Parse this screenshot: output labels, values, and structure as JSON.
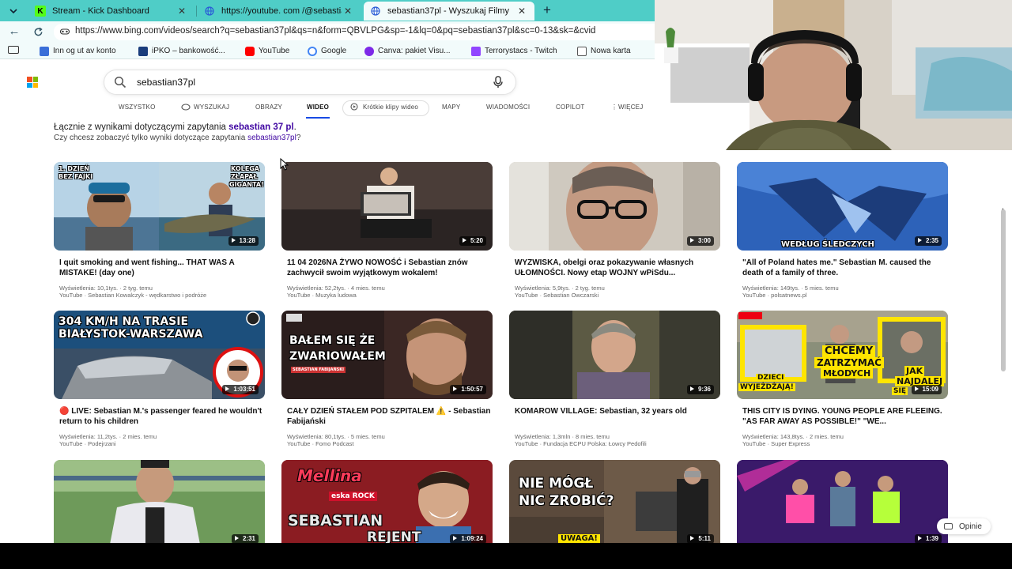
{
  "browser": {
    "tabs": [
      {
        "title": "Stream - Kick Dashboard",
        "favicon": "kick-favicon",
        "active": false
      },
      {
        "title": "https://youtube. com /@sebastian",
        "favicon": "globe-favicon",
        "active": false
      },
      {
        "title": "sebastian37pl - Wyszukaj Filmy",
        "favicon": "bing-favicon",
        "active": true
      }
    ],
    "url": "https://www.bing.com/videos/search?q=sebastian37pl&qs=n&form=QBVLPG&sp=-1&lq=0&pq=sebastian37pl&sc=0-13&sk=&cvid",
    "bookmarks": [
      {
        "label": "Inn og ut av konto",
        "icon": "puzzle-icon",
        "color": "#3b6fd8"
      },
      {
        "label": "iPKO – bankowość...",
        "icon": "pko-icon",
        "color": "#1a3d7c"
      },
      {
        "label": "YouTube",
        "icon": "youtube-icon",
        "color": "#ff0000"
      },
      {
        "label": "Google",
        "icon": "google-icon",
        "color": "#4285f4"
      },
      {
        "label": "Canva: pakiet Visu...",
        "icon": "canva-icon",
        "color": "#7d2ae8"
      },
      {
        "label": "Terrorystacs - Twitch",
        "icon": "twitch-icon",
        "color": "#9146ff"
      },
      {
        "label": "Nowa karta",
        "icon": "newtab-icon",
        "color": "#555555"
      }
    ]
  },
  "bing": {
    "query": "sebastian37pl",
    "scopes": [
      "WSZYSTKO",
      "WYSZUKAJ",
      "OBRAZY",
      "WIDEO",
      "Krótkie klipy wideo",
      "MAPY",
      "WIADOMOŚCI",
      "COPILOT",
      "WIĘCEJ"
    ],
    "active_scope": "WIDEO",
    "alt_line1_prefix": "Łącznie z wynikami dotyczącymi zapytania ",
    "alt_line1_link": "sebastian 37 pl",
    "alt_line1_suffix": ".",
    "alt_line2_prefix": "Czy chcesz zobaczyć tylko wyniki dotyczące zapytania ",
    "alt_line2_link": "sebastian37pl",
    "alt_line2_suffix": "?",
    "feedback_label": "Opinie",
    "colors": {
      "accent": "#174ae4",
      "link": "#4007a2",
      "chrome": "#4fcdc7"
    }
  },
  "videos": [
    {
      "title": "I quit smoking and went fishing... THAT WAS A MISTAKE! (day one)",
      "views": "Wyświetlenia: 10,1tys.",
      "age": "2 tyg. temu",
      "source": "YouTube",
      "channel": "Sebastian Kowalczyk - wędkarstwo i podróże",
      "duration": "13:28",
      "overlay": [
        "1. DZIEŃ",
        "BEZ FAJKI",
        "KOLEGA",
        "ZŁAPAŁ",
        "GIGANTA!"
      ]
    },
    {
      "title": "11 04 2026NA ŻYWO NOWOŚĆ i Sebastian znów zachwycił swoim wyjątkowym wokalem!",
      "views": "Wyświetlenia: 52,2tys.",
      "age": "4 mies. temu",
      "source": "YouTube",
      "channel": "Muzyka ludowa",
      "duration": "5:20",
      "overlay": []
    },
    {
      "title": "WYZWISKA, obelgi oraz pokazywanie własnych UŁOMNOŚCI. Nowy etap WOJNY wPiSdu...",
      "views": "Wyświetlenia: 5,9tys.",
      "age": "2 tyg. temu",
      "source": "YouTube",
      "channel": "Sebastian Owczarski",
      "duration": "3:00",
      "overlay": []
    },
    {
      "title": "\"All of Poland hates me.\" Sebastian M. caused the death of a family of three.",
      "views": "Wyświetlenia: 149tys.",
      "age": "5 mies. temu",
      "source": "YouTube",
      "channel": "polsatnews.pl",
      "duration": "2:35",
      "overlay": [
        "WEDŁUG ŚLEDCZYCH"
      ]
    },
    {
      "title": "🔴 LIVE: Sebastian M.'s passenger feared he wouldn't return to his children",
      "views": "Wyświetlenia: 11,2tys.",
      "age": "2 mies. temu",
      "source": "YouTube",
      "channel": "Podejrzani",
      "duration": "1:03:51",
      "overlay": [
        "304 KM/H NA TRASIE",
        "BIAŁYSTOK-WARSZAWA"
      ]
    },
    {
      "title": "CAŁY DZIEŃ STAŁEM POD SZPITALEM ⚠️ - Sebastian Fabijański",
      "views": "Wyświetlenia: 80,1tys.",
      "age": "5 mies. temu",
      "source": "YouTube",
      "channel": "Fomo Podcast",
      "duration": "1:50:57",
      "overlay": [
        "BAŁEM SIĘ ŻE",
        "ZWARIOWAŁEM",
        "SEBASTIAN FABIJAŃSKI"
      ]
    },
    {
      "title": "KOMAROW VILLAGE: Sebastian, 32 years old",
      "views": "Wyświetlenia: 1,3mln",
      "age": "8 mies. temu",
      "source": "YouTube",
      "channel": "Fundacja ECPU Polska: Łowcy Pedofili",
      "duration": "9:36",
      "overlay": []
    },
    {
      "title": "THIS CITY IS DYING. YOUNG PEOPLE ARE FLEEING. \"AS FAR AWAY AS POSSIBLE!\" \"WE...",
      "views": "Wyświetlenia: 143,8tys.",
      "age": "2 mies. temu",
      "source": "YouTube",
      "channel": "Super Express",
      "duration": "15:09",
      "overlay": [
        "CHCEMY",
        "ZATRZYMAĆ",
        "MŁODYCH",
        "DZIECI",
        "WYJEŻDŻAJĄ!",
        "JAK",
        "NAJDALEJ",
        "SIĘ"
      ]
    },
    {
      "title": "",
      "views": "",
      "age": "",
      "source": "",
      "channel": "",
      "duration": "2:31",
      "overlay": []
    },
    {
      "title": "",
      "views": "",
      "age": "",
      "source": "",
      "channel": "",
      "duration": "1:09:24",
      "overlay": [
        "Mellina",
        "eska ROCK",
        "SEBASTIAN",
        "REJENT"
      ]
    },
    {
      "title": "",
      "views": "",
      "age": "",
      "source": "",
      "channel": "",
      "duration": "5:11",
      "overlay": [
        "NIE MÓGŁ",
        "NIC ZROBIĆ?",
        "UWAGA!"
      ]
    },
    {
      "title": "",
      "views": "",
      "age": "",
      "source": "",
      "channel": "",
      "duration": "1:39",
      "overlay": []
    }
  ]
}
